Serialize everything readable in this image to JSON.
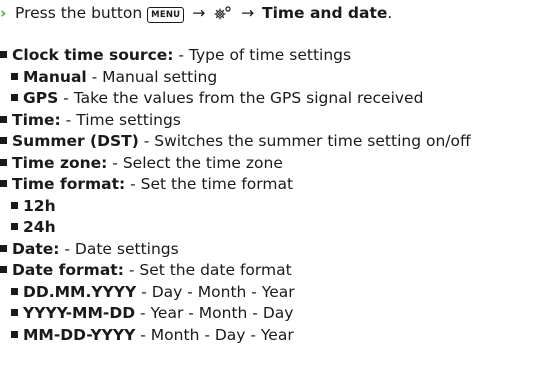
{
  "instruction": {
    "prefix": "Press the button",
    "menu_key": "MENU",
    "arrow": "→",
    "target": "Time and date",
    "suffix": "."
  },
  "items": [
    {
      "level": 0,
      "term": "Clock time source:",
      "desc": " - Type of time settings"
    },
    {
      "level": 1,
      "term": "Manual",
      "desc": " - Manual setting"
    },
    {
      "level": 1,
      "term": "GPS",
      "desc": " - Take the values from the GPS signal received"
    },
    {
      "level": 0,
      "term": "Time:",
      "desc": " - Time settings"
    },
    {
      "level": 0,
      "term": "Summer (DST)",
      "desc": " - Switches the summer time setting on/off"
    },
    {
      "level": 0,
      "term": "Time zone:",
      "desc": " - Select the time zone"
    },
    {
      "level": 0,
      "term": "Time format:",
      "desc": " - Set the time format"
    },
    {
      "level": 1,
      "term": "12h",
      "desc": ""
    },
    {
      "level": 1,
      "term": "24h",
      "desc": ""
    },
    {
      "level": 0,
      "term": "Date:",
      "desc": " - Date settings"
    },
    {
      "level": 0,
      "term": "Date format:",
      "desc": " - Set the date format"
    },
    {
      "level": 1,
      "term": "DD.MM.YYYY",
      "desc": " - Day - Month - Year"
    },
    {
      "level": 1,
      "term": "YYYY-MM-DD",
      "desc": " - Year - Month - Day"
    },
    {
      "level": 1,
      "term": "MM-DD-YYYY",
      "desc": " - Month - Day - Year"
    }
  ]
}
